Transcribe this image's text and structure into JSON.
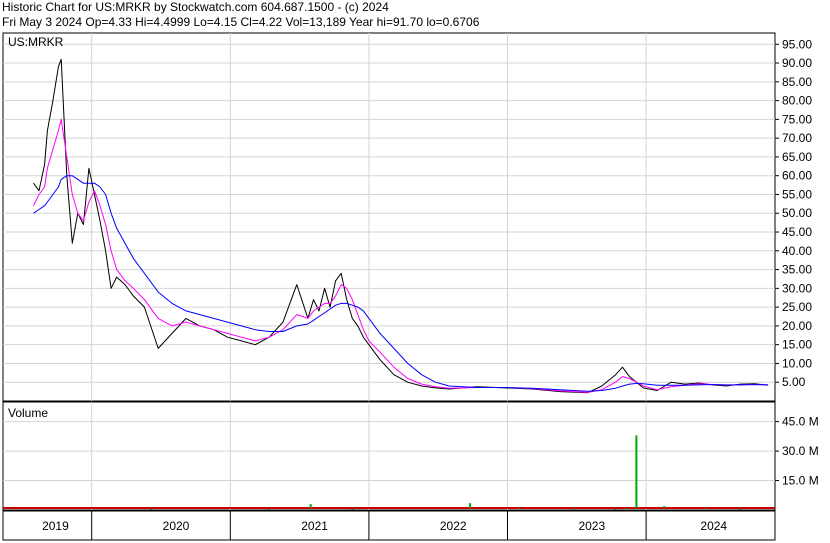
{
  "header": {
    "line1": "Historic Chart for US:MRKR by Stockwatch.com 604.687.1500 - (c) 2024",
    "line2": "Fri May  3 2024   Op=4.33   Hi=4.4999   Lo=4.15   Cl=4.22   Vol=13,189   Year hi=91.70   lo=0.6706"
  },
  "colors": {
    "price": "#000000",
    "ma_short": "#ff00ff",
    "ma_long": "#0000ff",
    "volume_up": "#00aa00",
    "volume_down": "#cc0000",
    "grid": "#d4d4d4"
  },
  "chart_data": [
    {
      "type": "line",
      "title": "US:MRKR",
      "ylim": [
        0,
        98
      ],
      "yticks": [
        "95.00",
        "90.00",
        "85.00",
        "80.00",
        "75.00",
        "70.00",
        "65.00",
        "60.00",
        "55.00",
        "50.00",
        "45.00",
        "40.00",
        "35.00",
        "30.00",
        "25.00",
        "20.00",
        "15.00",
        "10.00",
        "5.00"
      ],
      "x": [
        2019.0,
        2019.04,
        2019.08,
        2019.1,
        2019.14,
        2019.18,
        2019.2,
        2019.24,
        2019.28,
        2019.32,
        2019.36,
        2019.4,
        2019.44,
        2019.48,
        2019.52,
        2019.56,
        2019.6,
        2019.66,
        2019.72,
        2019.8,
        2019.9,
        2020.0,
        2020.1,
        2020.2,
        2020.3,
        2020.4,
        2020.5,
        2020.6,
        2020.7,
        2020.8,
        2020.9,
        2020.98,
        2021.02,
        2021.06,
        2021.1,
        2021.14,
        2021.18,
        2021.22,
        2021.26,
        2021.3,
        2021.34,
        2021.38,
        2021.42,
        2021.5,
        2021.6,
        2021.7,
        2021.8,
        2021.9,
        2022.0,
        2022.2,
        2022.4,
        2022.6,
        2022.8,
        2023.0,
        2023.1,
        2023.2,
        2023.25,
        2023.3,
        2023.35,
        2023.4,
        2023.5,
        2023.6,
        2023.7,
        2023.8,
        2023.9,
        2024.0,
        2024.1,
        2024.2,
        2024.3
      ],
      "series": [
        {
          "values": [
            58,
            56,
            63,
            72,
            80,
            89,
            91,
            60,
            42,
            50,
            47,
            62,
            55,
            48,
            40,
            30,
            33,
            31,
            28,
            25,
            14,
            18,
            22,
            20,
            19,
            17,
            16,
            15,
            17,
            21,
            31,
            22,
            27,
            24,
            30,
            25,
            32,
            34,
            27,
            22,
            20,
            17,
            15,
            11,
            7,
            5,
            4,
            3.5,
            3.2,
            3.8,
            3.5,
            3.2,
            2.5,
            2.2,
            4,
            7,
            9,
            6.5,
            5,
            3.5,
            2.8,
            5,
            4.5,
            4.8,
            4.3,
            4,
            4.5,
            4.6,
            4.22
          ]
        },
        {
          "values": [
            52,
            55,
            57,
            62,
            67,
            72,
            75,
            65,
            55,
            50,
            48,
            53,
            56,
            52,
            47,
            40,
            35,
            32,
            30,
            27,
            22,
            20,
            21,
            20,
            19,
            18,
            17,
            16,
            17,
            19,
            23,
            22,
            24,
            25,
            26,
            26,
            28,
            31,
            30,
            27,
            23,
            19,
            16,
            13,
            9,
            6,
            4.5,
            3.8,
            3.4,
            3.6,
            3.6,
            3.3,
            2.7,
            2.3,
            3,
            5,
            6.5,
            6,
            5,
            4,
            3,
            3.8,
            4.2,
            4.6,
            4.4,
            4.2,
            4.3,
            4.4,
            4.3
          ]
        },
        {
          "values": [
            50,
            51,
            52,
            53,
            55,
            57,
            59,
            60,
            60,
            59,
            58,
            58,
            58,
            57,
            55,
            50,
            46,
            42,
            38,
            34,
            29,
            26,
            24,
            23,
            22,
            21,
            20,
            19,
            18.5,
            18.5,
            20,
            20.5,
            21.5,
            22.5,
            23.5,
            24.5,
            25.5,
            26,
            26,
            25.5,
            25,
            24,
            22,
            18,
            14,
            10,
            7,
            5,
            4,
            3.6,
            3.6,
            3.4,
            3,
            2.6,
            2.8,
            3.4,
            4,
            4.5,
            4.7,
            4.6,
            4.2,
            4.2,
            4.2,
            4.3,
            4.4,
            4.3,
            4.3,
            4.4,
            4.3
          ]
        }
      ]
    },
    {
      "type": "bar",
      "title": "Volume",
      "ylim": [
        0,
        55
      ],
      "yticks": [
        "45.0 M",
        "30.0 M",
        "15.0 M"
      ],
      "x": [
        2019.85,
        2020.7,
        2021.0,
        2021.3,
        2022.15,
        2022.5,
        2022.9,
        2023.2,
        2023.28,
        2023.35,
        2023.55,
        2023.85,
        2024.1
      ],
      "values": [
        0.8,
        0.6,
        3.0,
        0.8,
        3.5,
        1.0,
        0.9,
        0.8,
        1.0,
        38.0,
        2.0,
        1.2,
        0.8
      ]
    }
  ],
  "xaxis": {
    "range": [
      2018.78,
      2024.35
    ],
    "separators": [
      2019.42,
      2020.42,
      2021.42,
      2022.42,
      2023.42
    ],
    "labels": [
      {
        "text": "2019",
        "x": 2019.05
      },
      {
        "text": "2020",
        "x": 2019.92
      },
      {
        "text": "2021",
        "x": 2020.92
      },
      {
        "text": "2022",
        "x": 2021.92
      },
      {
        "text": "2023",
        "x": 2022.92
      },
      {
        "text": "2024",
        "x": 2023.8
      }
    ]
  }
}
